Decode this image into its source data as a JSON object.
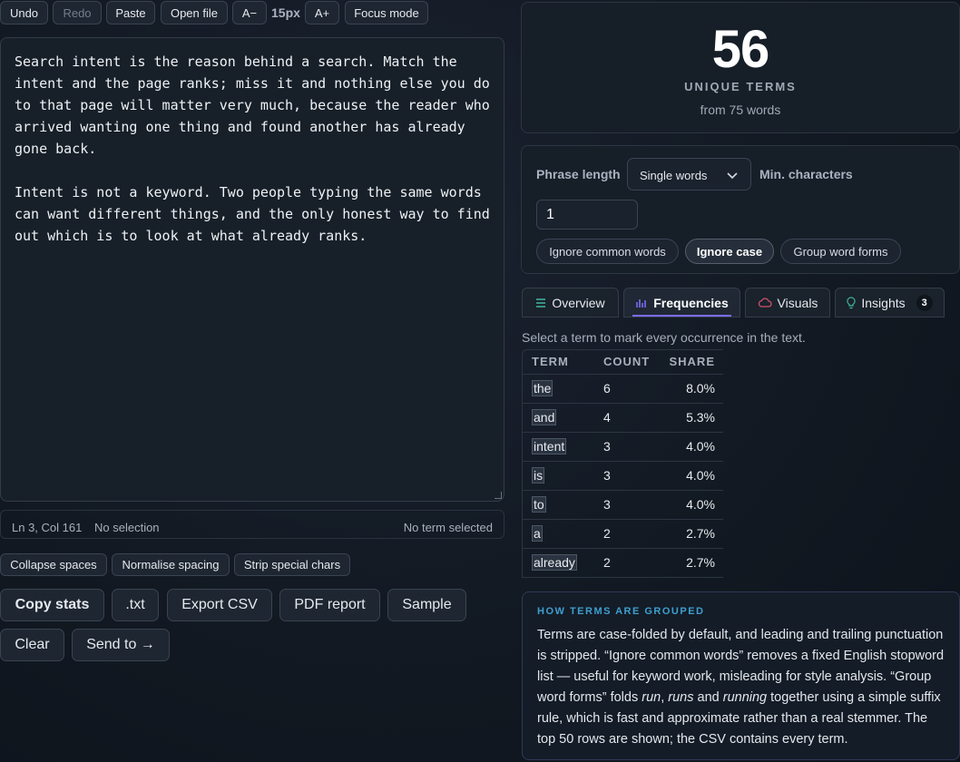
{
  "toolbar": {
    "undo": "Undo",
    "redo": "Redo",
    "paste": "Paste",
    "open_file": "Open file",
    "font_smaller": "A−",
    "font_size": "15px",
    "font_larger": "A+",
    "focus_mode": "Focus mode"
  },
  "editor": {
    "paragraph_1": "Search intent is the reason behind a search. Match the intent and the page ranks; miss it and nothing else you do to that page will matter very much, because the reader who arrived wanting one thing and found another has already gone back.",
    "paragraph_2": "Intent is not a keyword. Two people typing the same words can want different things, and the only honest way to find out which is to look at what already ranks."
  },
  "status": {
    "position": "Ln 3, Col 161",
    "selection": "No selection",
    "term_selected": "No term selected"
  },
  "cleanup": {
    "collapse_spaces": "Collapse spaces",
    "normalise_spacing": "Normalise spacing",
    "strip_special": "Strip special chars"
  },
  "actions": {
    "copy_stats": "Copy stats",
    "txt": ".txt",
    "export_csv": "Export CSV",
    "pdf_report": "PDF report",
    "sample": "Sample",
    "clear": "Clear",
    "send_to": "Send to →"
  },
  "summary": {
    "unique_count": "56",
    "unique_label": "UNIQUE TERMS",
    "from_words": "from 75 words"
  },
  "options": {
    "phrase_length_label": "Phrase length",
    "phrase_length_value": "Single words",
    "min_chars_label": "Min. characters",
    "min_chars_value": "1",
    "ignore_common": "Ignore common words",
    "ignore_case": "Ignore case",
    "group_forms": "Group word forms"
  },
  "tabs": {
    "overview": "Overview",
    "frequencies": "Frequencies",
    "visuals": "Visuals",
    "insights": "Insights",
    "insights_badge": "3"
  },
  "frequencies": {
    "hint": "Select a term to mark every occurrence in the text.",
    "headers": [
      "TERM",
      "COUNT",
      "SHARE"
    ],
    "rows": [
      {
        "term": "the",
        "count": "6",
        "share": "8.0%"
      },
      {
        "term": "and",
        "count": "4",
        "share": "5.3%"
      },
      {
        "term": "intent",
        "count": "3",
        "share": "4.0%"
      },
      {
        "term": "is",
        "count": "3",
        "share": "4.0%"
      },
      {
        "term": "to",
        "count": "3",
        "share": "4.0%"
      },
      {
        "term": "a",
        "count": "2",
        "share": "2.7%"
      },
      {
        "term": "already",
        "count": "2",
        "share": "2.7%"
      }
    ]
  },
  "note": {
    "title": "HOW TERMS ARE GROUPED",
    "part1": "Terms are case-folded by default, and leading and trailing punctuation is stripped. “Ignore common words” removes a fixed English stopword list — useful for keyword work, misleading for style analysis. “Group word forms” folds ",
    "word1": "run",
    "sep1": ", ",
    "word2": "runs",
    "sep2": " and ",
    "word3": "running",
    "part2": " together using a simple suffix rule, which is fast and approximate rather than a real stemmer. The top 50 rows are shown; the CSV contains every term."
  },
  "colors": {
    "accent_tab": "#7b6cf0",
    "note_title": "#3e9fcf",
    "visuals_icon": "#d0516b",
    "insights_icon": "#3fb8a0"
  }
}
